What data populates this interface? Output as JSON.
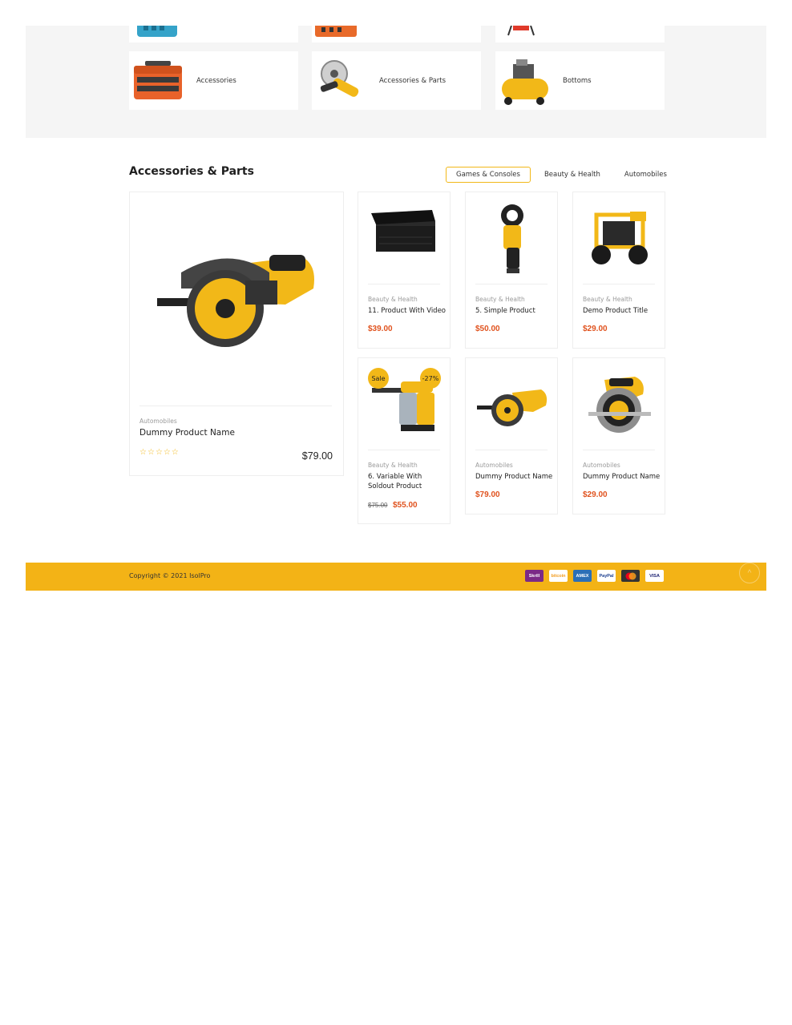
{
  "categories": {
    "top_row": [
      {
        "label": ""
      },
      {
        "label": ""
      },
      {
        "label": ""
      }
    ],
    "bottom_row": [
      {
        "label": "Accessories",
        "icon": "toolbox-icon"
      },
      {
        "label": "Accessories & Parts",
        "icon": "grinder-icon"
      },
      {
        "label": "Bottoms",
        "icon": "compressor-icon"
      }
    ]
  },
  "section": {
    "title": "Accessories & Parts",
    "tabs": [
      {
        "label": "Games & Consoles",
        "active": true
      },
      {
        "label": "Beauty & Health",
        "active": false
      },
      {
        "label": "Automobiles",
        "active": false
      }
    ]
  },
  "featured": {
    "category": "Automobiles",
    "name": "Dummy Product Name",
    "price": "$79.00",
    "rating": 0,
    "rating_max": 5,
    "icon": "circular-saw-icon"
  },
  "products": [
    {
      "category": "Beauty & Health",
      "name": "11. Product With Video",
      "price": "$39.00",
      "icon": "tool-chest-icon"
    },
    {
      "category": "Beauty & Health",
      "name": "5. Simple Product",
      "price": "$50.00",
      "icon": "cable-cutter-icon"
    },
    {
      "category": "Beauty & Health",
      "name": "Demo Product Title",
      "price": "$29.00",
      "icon": "pressure-washer-icon"
    },
    {
      "category": "Beauty & Health",
      "name": "6. Variable With Soldout Product",
      "old_price": "$75.00",
      "price": "$55.00",
      "sale_badge": "Sale",
      "discount_badge": "-27%",
      "icon": "dust-extractor-icon"
    },
    {
      "category": "Automobiles",
      "name": "Dummy Product Name",
      "price": "$79.00",
      "icon": "circular-saw-icon"
    },
    {
      "category": "Automobiles",
      "name": "Dummy Product Name",
      "price": "$29.00",
      "icon": "circular-saw-icon"
    }
  ],
  "footer": {
    "copyright": "Copyright © 2021 IsolPro",
    "payments": [
      {
        "label": "Skrill",
        "color": "#7b2a86"
      },
      {
        "label": "bitcoin",
        "color": "#ffffff"
      },
      {
        "label": "AMEX",
        "color": "#2b6fb6"
      },
      {
        "label": "PayPal",
        "color": "#ffffff"
      },
      {
        "label": "MC",
        "color": "#333333"
      },
      {
        "label": "VISA",
        "color": "#ffffff"
      }
    ]
  },
  "colors": {
    "accent": "#f3b316",
    "price": "#e0531f",
    "band": "#f5f5f5"
  }
}
